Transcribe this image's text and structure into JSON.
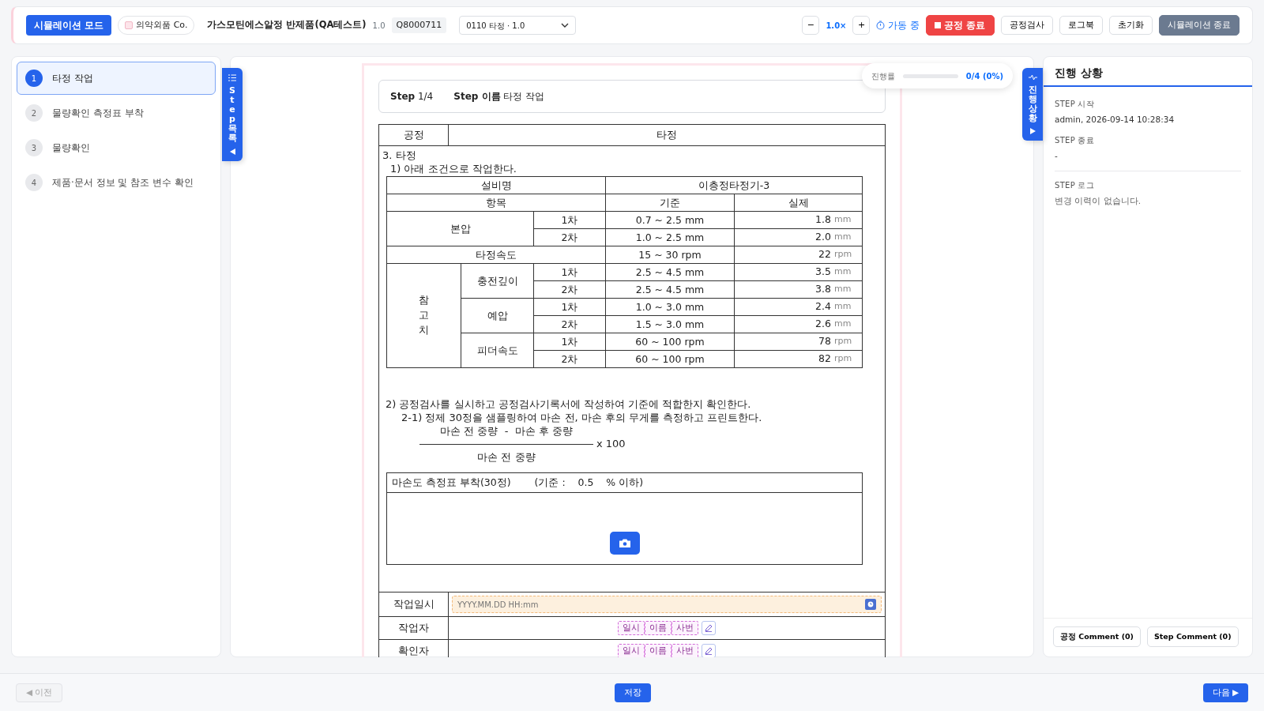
{
  "topbar": {
    "mode_badge": "시뮬레이션 모드",
    "company": "의약외품 Co.",
    "product": "가스모틴에스알정 반제품(QA테스트)",
    "version": "1.0",
    "code": "Q8000711",
    "process_select": "0110 타정 · 1.0",
    "zoom_out": "−",
    "zoom": "1.0×",
    "zoom_in": "+",
    "status": "가동 중",
    "buttons": [
      {
        "label": "공정 종료",
        "kind": "danger"
      },
      {
        "label": "공정검사",
        "kind": "outline"
      },
      {
        "label": "로그북",
        "kind": "outline"
      },
      {
        "label": "초기화",
        "kind": "outline"
      },
      {
        "label": "시뮬레이션 종료",
        "kind": "secondary"
      }
    ]
  },
  "steps": [
    {
      "number": "1",
      "label": "타정 작업",
      "selected": true
    },
    {
      "number": "2",
      "label": "물량확인 측정표 부착",
      "selected": false
    },
    {
      "number": "3",
      "label": "물량확인",
      "selected": false
    },
    {
      "number": "4",
      "label": "제품·문서 정보 및 참조 변수 확인",
      "selected": false
    }
  ],
  "step_tab": "Step 목록",
  "progress_tab": "진행 상황",
  "progress": {
    "label": "진행률",
    "level": 0,
    "reading": "0/4 (0%)"
  },
  "step_header": {
    "step_label": "Step",
    "step_value": "1/4",
    "name_label": "Step 이름",
    "name_value": "타정 작업"
  },
  "document": {
    "process_label": "공정",
    "process_value": "타정",
    "section_title": "3. 타정",
    "instruction_1": "1) 아래 조건으로 작업한다.",
    "equipment": {
      "label": "설비명",
      "value": "이층정타정기-3"
    },
    "headers": {
      "item": "항목",
      "standard": "기준",
      "actual": "실제"
    },
    "groups": [
      {
        "kind": "split",
        "label": "본압",
        "rows": [
          {
            "order": "1차",
            "standard": "0.7 ~ 2.5 mm",
            "actual": "1.8",
            "unit": "mm"
          },
          {
            "order": "2차",
            "standard": "1.0 ~ 2.5 mm",
            "actual": "2.0",
            "unit": "mm"
          }
        ]
      },
      {
        "kind": "single",
        "label": "타정속도",
        "rows": [
          {
            "standard": "15 ~ 30 rpm",
            "actual": "22",
            "unit": "rpm"
          }
        ]
      },
      {
        "kind": "nested",
        "label": "참고치",
        "subgroups": [
          {
            "label": "충전깊이",
            "rows": [
              {
                "order": "1차",
                "standard": "2.5 ~ 4.5 mm",
                "actual": "3.5",
                "unit": "mm"
              },
              {
                "order": "2차",
                "standard": "2.5 ~ 4.5 mm",
                "actual": "3.8",
                "unit": "mm"
              }
            ]
          },
          {
            "label": "예압",
            "rows": [
              {
                "order": "1차",
                "standard": "1.0 ~ 3.0 mm",
                "actual": "2.4",
                "unit": "mm"
              },
              {
                "order": "2차",
                "standard": "1.5 ~ 3.0 mm",
                "actual": "2.6",
                "unit": "mm"
              }
            ]
          },
          {
            "label": "피더속도",
            "rows": [
              {
                "order": "1차",
                "standard": "60 ~ 100 rpm",
                "actual": "78",
                "unit": "rpm"
              },
              {
                "order": "2차",
                "standard": "60 ~ 100 rpm",
                "actual": "82",
                "unit": "rpm"
              }
            ]
          }
        ]
      }
    ],
    "instruction_2": "2) 공정검사를 실시하고 공정검사기록서에 작성하여 기준에 적합한지 확인한다.",
    "instruction_2_1": "2-1) 정제 30정을 샘플링하여 마손 전, 마손 후의 무게를 측정하고 프린트한다.",
    "formula": {
      "numerator": "마손 전 중량  -  마손 후 중량",
      "multiplier": "x 100",
      "denominator": "마손 전 중량"
    },
    "attachment": {
      "title": "마손도 측정표 부착(30정)",
      "criterion": "(기준 :    0.5    % 이하)"
    },
    "sign_rows": [
      {
        "kind": "datetime",
        "label": "작업일시",
        "placeholder": "YYYY.MM.DD HH:mm"
      },
      {
        "kind": "signature",
        "label": "작업자",
        "chips": [
          "일시",
          "이름",
          "사번"
        ]
      },
      {
        "kind": "signature",
        "label": "확인자",
        "chips": [
          "일시",
          "이름",
          "사번"
        ]
      }
    ]
  },
  "status_panel": {
    "title": "진행 상황",
    "sections": [
      {
        "kind": "info",
        "label": "STEP 시작",
        "value": "admin, 2026-09-14 10:28:34"
      },
      {
        "kind": "info",
        "label": "STEP 종료",
        "value": "-"
      },
      {
        "kind": "log",
        "label": "STEP 로그",
        "value": "변경 이력이 없습니다."
      }
    ],
    "comment_buttons": [
      "공정 Comment (0)",
      "Step Comment (0)"
    ]
  },
  "footer": {
    "prev": {
      "label": "◀ 이전",
      "disabled": true
    },
    "save": "저장",
    "next": "다음 ▶"
  }
}
